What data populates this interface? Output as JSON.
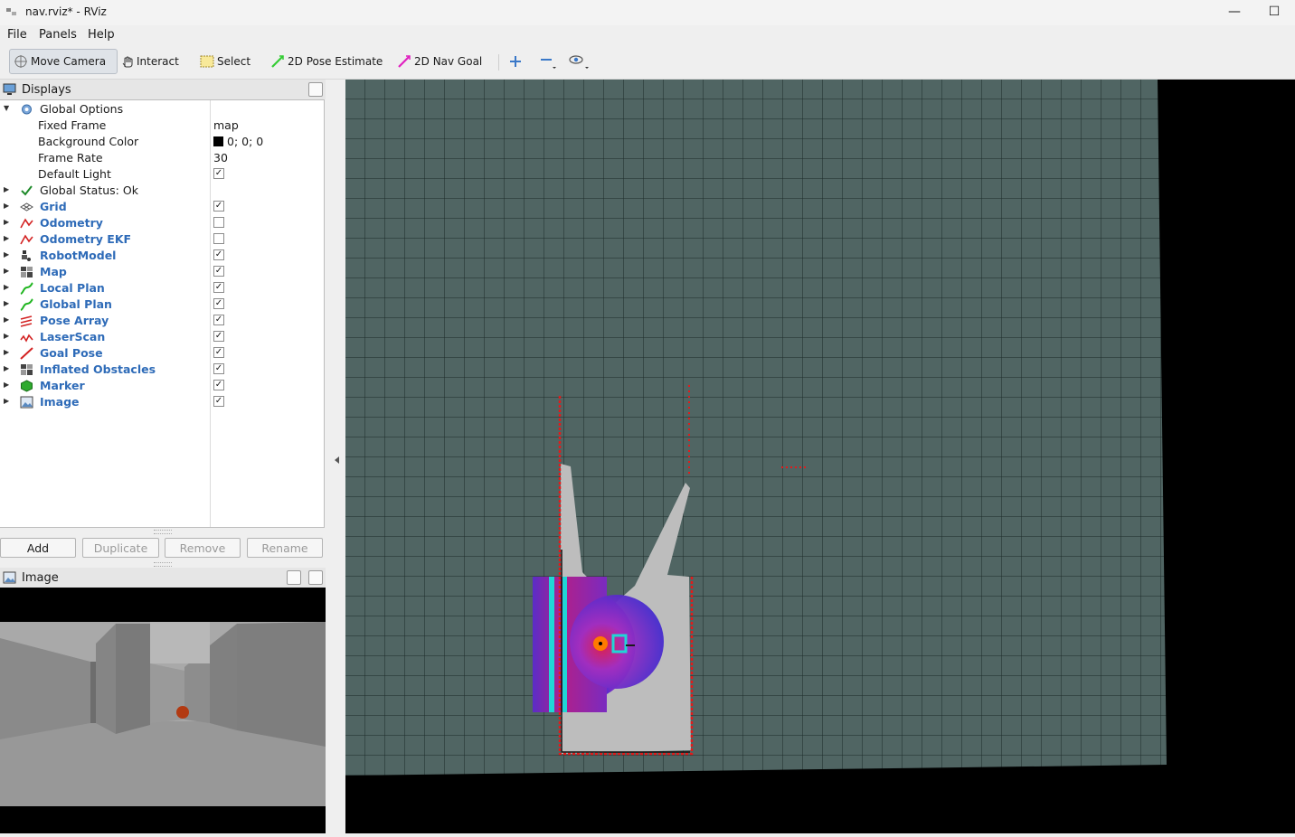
{
  "window": {
    "title": "nav.rviz* - RViz",
    "minimize": "—",
    "maximize": "☐"
  },
  "menu": [
    {
      "label": "File"
    },
    {
      "label": "Panels"
    },
    {
      "label": "Help"
    }
  ],
  "toolbar": {
    "move_camera": "Move Camera",
    "interact": "Interact",
    "select": "Select",
    "pose_estimate": "2D Pose Estimate",
    "nav_goal": "2D Nav Goal",
    "pose_color": "#33cc33",
    "goal_color": "#e020c0"
  },
  "displays_panel": {
    "title": "Displays",
    "global_options": {
      "label": "Global Options",
      "fixed_frame_label": "Fixed Frame",
      "fixed_frame_value": "map",
      "background_color_label": "Background Color",
      "background_color_value": "0; 0; 0",
      "frame_rate_label": "Frame Rate",
      "frame_rate_value": "30",
      "default_light_label": "Default Light",
      "default_light_checked": true
    },
    "global_status": "Global Status: Ok",
    "items": [
      {
        "label": "Grid",
        "icon": "grid-icon",
        "enabled": true
      },
      {
        "label": "Odometry",
        "icon": "odometry-icon",
        "enabled": false
      },
      {
        "label": "Odometry EKF",
        "icon": "odometry-icon",
        "enabled": false
      },
      {
        "label": "RobotModel",
        "icon": "robot-model-icon",
        "enabled": true
      },
      {
        "label": "Map",
        "icon": "map-icon",
        "enabled": true
      },
      {
        "label": "Local Plan",
        "icon": "path-icon",
        "enabled": true
      },
      {
        "label": "Global Plan",
        "icon": "path-icon",
        "enabled": true
      },
      {
        "label": "Pose Array",
        "icon": "pose-array-icon",
        "enabled": true
      },
      {
        "label": "LaserScan",
        "icon": "laser-scan-icon",
        "enabled": true
      },
      {
        "label": "Goal Pose",
        "icon": "pose-icon",
        "enabled": true
      },
      {
        "label": "Inflated Obstacles",
        "icon": "map-icon",
        "enabled": true
      },
      {
        "label": "Marker",
        "icon": "marker-icon",
        "enabled": true
      },
      {
        "label": "Image",
        "icon": "image-icon",
        "enabled": true
      }
    ],
    "buttons": {
      "add": "Add",
      "duplicate": "Duplicate",
      "remove": "Remove",
      "rename": "Rename"
    }
  },
  "image_panel": {
    "title": "Image"
  },
  "viewport": {
    "grid_color": "#4f6361",
    "background": "#000000"
  }
}
